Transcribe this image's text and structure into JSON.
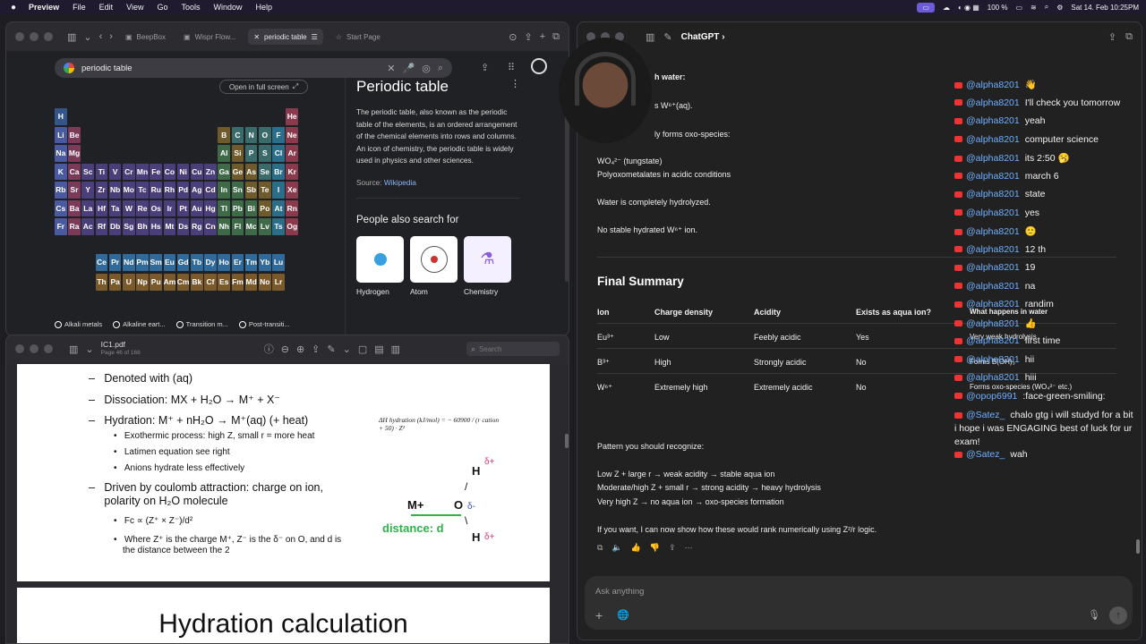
{
  "menubar": {
    "apple": "",
    "items": [
      "Preview",
      "File",
      "Edit",
      "View",
      "Go",
      "Tools",
      "Window",
      "Help"
    ],
    "status": {
      "battery": "100 %",
      "clock": "Sat 14. Feb 10:25PM"
    }
  },
  "browser": {
    "tabs": [
      "BeepBox",
      "Wispr Flow...",
      "periodic table",
      "Start Page"
    ],
    "search_value": "periodic table",
    "open_full_screen": "Open in full screen",
    "kp_title": "Periodic table",
    "kp_desc": "The periodic table, also known as the periodic table of the elements, is an ordered arrangement of the chemical elements into rows and columns. An icon of chemistry, the periodic table is widely used in physics and other sciences.",
    "kp_source_label": "Source:",
    "kp_source_link": "Wikipedia",
    "people_also_search": "People also search for",
    "related": [
      "Hydrogen",
      "Atom",
      "Chemistry"
    ],
    "legend": [
      "Alkali metals",
      "Alkaline eart...",
      "Transition m...",
      "Post-transiti..."
    ]
  },
  "periodic_table": {
    "rows": [
      [
        "H",
        "",
        "",
        "",
        "",
        "",
        "",
        "",
        "",
        "",
        "",
        "",
        "",
        "",
        "",
        "",
        "",
        "He"
      ],
      [
        "Li",
        "Be",
        "",
        "",
        "",
        "",
        "",
        "",
        "",
        "",
        "",
        "",
        "B",
        "C",
        "N",
        "O",
        "F",
        "Ne"
      ],
      [
        "Na",
        "Mg",
        "",
        "",
        "",
        "",
        "",
        "",
        "",
        "",
        "",
        "",
        "Al",
        "Si",
        "P",
        "S",
        "Cl",
        "Ar"
      ],
      [
        "K",
        "Ca",
        "Sc",
        "Ti",
        "V",
        "Cr",
        "Mn",
        "Fe",
        "Co",
        "Ni",
        "Cu",
        "Zn",
        "Ga",
        "Ge",
        "As",
        "Se",
        "Br",
        "Kr"
      ],
      [
        "Rb",
        "Sr",
        "Y",
        "Zr",
        "Nb",
        "Mo",
        "Tc",
        "Ru",
        "Rh",
        "Pd",
        "Ag",
        "Cd",
        "In",
        "Sn",
        "Sb",
        "Te",
        "I",
        "Xe"
      ],
      [
        "Cs",
        "Ba",
        "La",
        "Hf",
        "Ta",
        "W",
        "Re",
        "Os",
        "Ir",
        "Pt",
        "Au",
        "Hg",
        "Tl",
        "Pb",
        "Bi",
        "Po",
        "At",
        "Rn"
      ],
      [
        "Fr",
        "Ra",
        "Ac",
        "Rf",
        "Db",
        "Sg",
        "Bh",
        "Hs",
        "Mt",
        "Ds",
        "Rg",
        "Cn",
        "Nh",
        "Fl",
        "Mc",
        "Lv",
        "Ts",
        "Og"
      ]
    ],
    "lanthanides": [
      "Ce",
      "Pr",
      "Nd",
      "Pm",
      "Sm",
      "Eu",
      "Gd",
      "Tb",
      "Dy",
      "Ho",
      "Er",
      "Tm",
      "Yb",
      "Lu"
    ],
    "actinides": [
      "Th",
      "Pa",
      "U",
      "Np",
      "Pu",
      "Am",
      "Cm",
      "Bk",
      "Cf",
      "Es",
      "Fm",
      "Md",
      "No",
      "Lr"
    ]
  },
  "pdf": {
    "filename": "IC1.pdf",
    "page_info": "Page 46 of 168",
    "search_placeholder": "Search",
    "lines": [
      "Denoted with (aq)",
      "Dissociation: MX + H₂O → M⁺ + X⁻",
      "Hydration: M⁺ + nH₂O → M⁺(aq) (+ heat)",
      "Driven by coulomb attraction: charge on ion,",
      "polarity on H₂O molecule"
    ],
    "sub": [
      "Exothermic process: high Z, small r = more heat",
      "Latimen equation see right",
      "Anions hydrate less effectively",
      "Fc ∝ (Z⁺ × Z⁻)/d²",
      "Where Z⁺ is the charge M⁺, Z⁻ is the δ⁻ on O, and d is",
      "the distance between the 2"
    ],
    "equation": "ΔH hydration (kJ/mol) = − 60900 / (r cation + 50) · Z²",
    "diagram": {
      "m": "M+",
      "o": "O",
      "h": "H",
      "dplus": "δ+",
      "dminus": "δ-",
      "distance": "distance: d"
    },
    "next_slide_title": "Hydration calculation"
  },
  "chatgpt": {
    "title": "ChatGPT",
    "partial": [
      "h water:",
      "s W⁶⁺(aq).",
      "ly forms oxo-species:"
    ],
    "lines": [
      "WO₄²⁻ (tungstate)",
      "Polyoxometalates in acidic conditions",
      "Water is completely hydrolyzed.",
      "No stable hydrated W⁶⁺ ion."
    ],
    "final_summary": "Final Summary",
    "table_headers": [
      "Ion",
      "Charge density",
      "Acidity",
      "Exists as aqua ion?",
      "What happens in water"
    ],
    "table_rows": [
      [
        "Eu³⁺",
        "Low",
        "Feebly acidic",
        "Yes",
        "Very weak hydrolysis"
      ],
      [
        "B³⁺",
        "High",
        "Strongly acidic",
        "No",
        "Forms B(OH)₃"
      ],
      [
        "W⁶⁺",
        "Extremely high",
        "Extremely acidic",
        "No",
        "Forms oxo-species (WO₄²⁻ etc.)"
      ]
    ],
    "pattern_title": "Pattern you should recognize:",
    "patterns": [
      "Low Z + large r → weak acidity → stable aqua ion",
      "Moderate/high Z + small r → strong acidity → heavy hydrolysis",
      "Very high Z → no aqua ion → oxo-species formation"
    ],
    "followup": "If you want, I can now show how these would rank numerically using Z²/r logic.",
    "input_placeholder": "Ask anything"
  },
  "live_chat": [
    {
      "user": "@alpha8201",
      "msg": "👋"
    },
    {
      "user": "@alpha8201",
      "msg": "I'll check you tomorrow"
    },
    {
      "user": "@alpha8201",
      "msg": "yeah"
    },
    {
      "user": "@alpha8201",
      "msg": "computer science"
    },
    {
      "user": "@alpha8201",
      "msg": "its 2:50 🥱"
    },
    {
      "user": "@alpha8201",
      "msg": "march 6"
    },
    {
      "user": "@alpha8201",
      "msg": "state"
    },
    {
      "user": "@alpha8201",
      "msg": "yes"
    },
    {
      "user": "@alpha8201",
      "msg": "🙂"
    },
    {
      "user": "@alpha8201",
      "msg": "12 th"
    },
    {
      "user": "@alpha8201",
      "msg": "19"
    },
    {
      "user": "@alpha8201",
      "msg": "na"
    },
    {
      "user": "@alpha8201",
      "msg": "randim"
    },
    {
      "user": "@alpha8201",
      "msg": "👍"
    },
    {
      "user": "@alpha8201",
      "msg": "first time"
    },
    {
      "user": "@alpha8201",
      "msg": "hii"
    },
    {
      "user": "@alpha8201",
      "msg": "hiii"
    },
    {
      "user": "@opop6991",
      "msg": ":face-green-smiling:"
    },
    {
      "user": "@Satez_",
      "msg": "chalo gtg i will studyd for a bit i hope i was ENGAGING best of luck for ur exam!"
    },
    {
      "user": "@Satez_",
      "msg": "wah"
    }
  ]
}
